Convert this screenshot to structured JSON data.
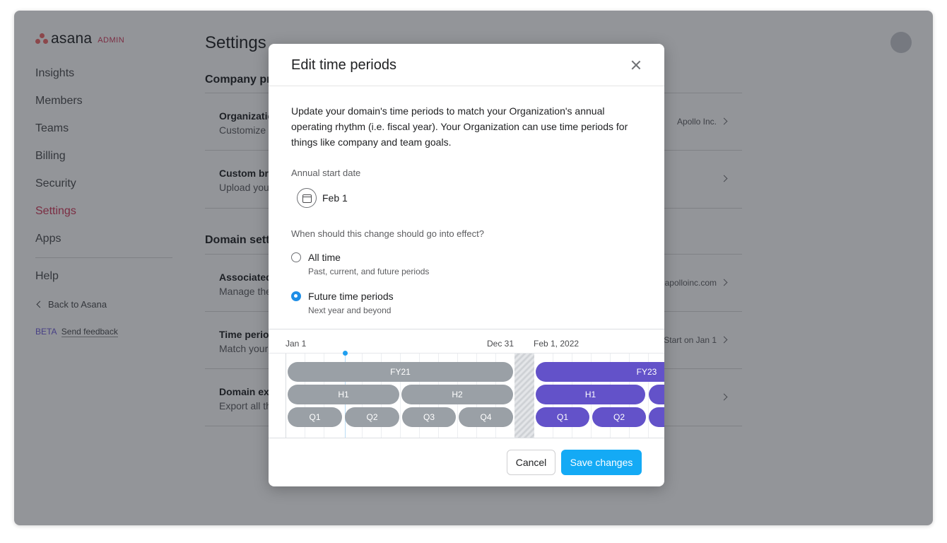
{
  "sidebar": {
    "logo_word": "asana",
    "logo_admin": "ADMIN",
    "nav": [
      {
        "label": "Insights",
        "active": false
      },
      {
        "label": "Members",
        "active": false
      },
      {
        "label": "Teams",
        "active": false
      },
      {
        "label": "Billing",
        "active": false
      },
      {
        "label": "Security",
        "active": false
      },
      {
        "label": "Settings",
        "active": true
      },
      {
        "label": "Apps",
        "active": false
      }
    ],
    "help": "Help",
    "back": "Back to Asana",
    "beta_tag": "BETA",
    "feedback": "Send feedback"
  },
  "main": {
    "title": "Settings",
    "company_section": "Company pr",
    "domain_section": "Domain sett",
    "rows": [
      {
        "title": "Organizatio",
        "sub": "Customize .",
        "value": "Apollo Inc."
      },
      {
        "title": "Custom bra",
        "sub": "Upload you",
        "value": ""
      },
      {
        "title": "Associated",
        "sub": "Manage the",
        "value": "apolloinc.com"
      },
      {
        "title": "Time perio",
        "sub": "Match your",
        "value": "Start on Jan 1"
      },
      {
        "title": "Domain exp",
        "sub": "Export all th",
        "value": ""
      }
    ]
  },
  "modal": {
    "title": "Edit time periods",
    "description": "Update your domain's time periods to match your Organization's annual operating rhythm (i.e. fiscal year). Your Organization can use time periods for things like company and team goals.",
    "start_label": "Annual start date",
    "start_value": "Feb 1",
    "effect_label": "When should this change should go into effect?",
    "options": [
      {
        "label": "All time",
        "sub": "Past, current, and future periods",
        "checked": false
      },
      {
        "label": "Future time periods",
        "sub": "Next year and beyond",
        "checked": true
      }
    ],
    "timeline": {
      "dates": [
        "Jan 1",
        "Dec 31",
        "Feb 1, 2022"
      ],
      "gray": {
        "fy": "FY21",
        "halves": [
          "H1",
          "H2"
        ],
        "quarters": [
          "Q1",
          "Q2",
          "Q3",
          "Q4"
        ]
      },
      "purple": {
        "fy": "FY23",
        "halves": [
          "H1",
          ""
        ],
        "quarters": [
          "Q1",
          "Q2",
          ""
        ]
      }
    },
    "cancel": "Cancel",
    "save": "Save changes"
  },
  "colors": {
    "accent": "#14aaf5",
    "active_nav": "#d1395a",
    "new_period": "#6352c9",
    "old_period": "#9aa0a6"
  }
}
